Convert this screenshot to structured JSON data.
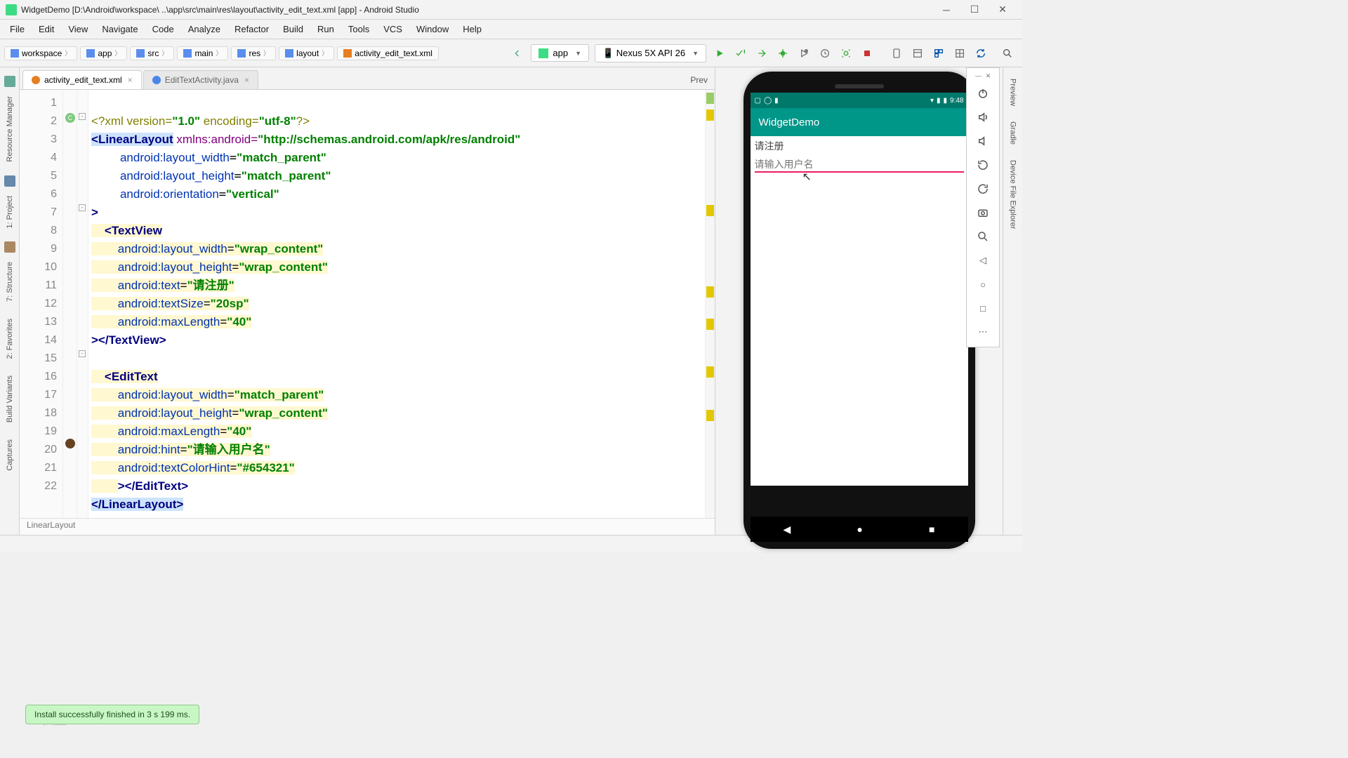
{
  "window": {
    "title": "WidgetDemo [D:\\Android\\workspace\\ ..\\app\\src\\main\\res\\layout\\activity_edit_text.xml [app] - Android Studio"
  },
  "menu": [
    "File",
    "Edit",
    "View",
    "Navigate",
    "Code",
    "Analyze",
    "Refactor",
    "Build",
    "Run",
    "Tools",
    "VCS",
    "Window",
    "Help"
  ],
  "breadcrumbs": [
    "workspace",
    "app",
    "src",
    "main",
    "res",
    "layout",
    "activity_edit_text.xml"
  ],
  "run_config": {
    "app": "app",
    "device": "Nexus 5X API 26"
  },
  "tabs": [
    {
      "label": "activity_edit_text.xml",
      "kind": "xml",
      "active": true
    },
    {
      "label": "EditTextActivity.java",
      "kind": "java",
      "active": false
    }
  ],
  "preview_label": "Prev",
  "left_tabs": [
    "Resource Manager",
    "1: Project",
    "7: Structure",
    "2: Favorites",
    "Build Variants",
    "Captures"
  ],
  "right_tabs": [
    "Preview",
    "Gradle",
    "Device File Explorer"
  ],
  "lines": [
    1,
    2,
    3,
    4,
    5,
    6,
    7,
    8,
    9,
    10,
    11,
    12,
    13,
    14,
    15,
    16,
    17,
    18,
    19,
    20,
    21,
    22
  ],
  "xml": {
    "l1a": "<?xml version=",
    "l1b": "\"1.0\"",
    "l1c": " encoding=",
    "l1d": "\"utf-8\"",
    "l1e": "?>",
    "l2a": "<",
    "l2t": "LinearLayout",
    "l2b": " xmlns:android=",
    "l2s": "\"http://schemas.android.com/apk/res/android\"",
    "l3a": "android:layout_width",
    "l3s": "\"match_parent\"",
    "l4a": "android:layout_height",
    "l4s": "\"match_parent\"",
    "l5a": "android:orientation",
    "l5s": "\"vertical\"",
    "l6": ">",
    "l7a": "<",
    "l7t": "TextView",
    "l8a": "android:layout_width",
    "l8s": "\"wrap_content\"",
    "l9a": "android:layout_height",
    "l9s": "\"wrap_content\"",
    "l10a": "android:text",
    "l10s": "\"请注册\"",
    "l11a": "android:textSize",
    "l11s": "\"20sp\"",
    "l12a": "android:maxLength",
    "l12s": "\"40\"",
    "l13": "></TextView>",
    "l15a": "<",
    "l15t": "EditText",
    "l16a": "android:layout_width",
    "l16s": "\"match_parent\"",
    "l17a": "android:layout_height",
    "l17s": "\"wrap_content\"",
    "l18a": "android:maxLength",
    "l18s": "\"40\"",
    "l19a": "android:hint",
    "l19s": "\"请输入用户名\"",
    "l20a": "android:textColorHint",
    "l20s": "\"#654321\"",
    "l21": "></EditText>",
    "l22": "</LinearLayout>"
  },
  "device_preview": {
    "time": "9:48",
    "app_title": "WidgetDemo",
    "textview": "请注册",
    "hint": "请输入用户名"
  },
  "breadcrumb_path": "LinearLayout",
  "toast": "Install successfully finished in 3 s 199 ms.",
  "watermark": "IT私塾"
}
